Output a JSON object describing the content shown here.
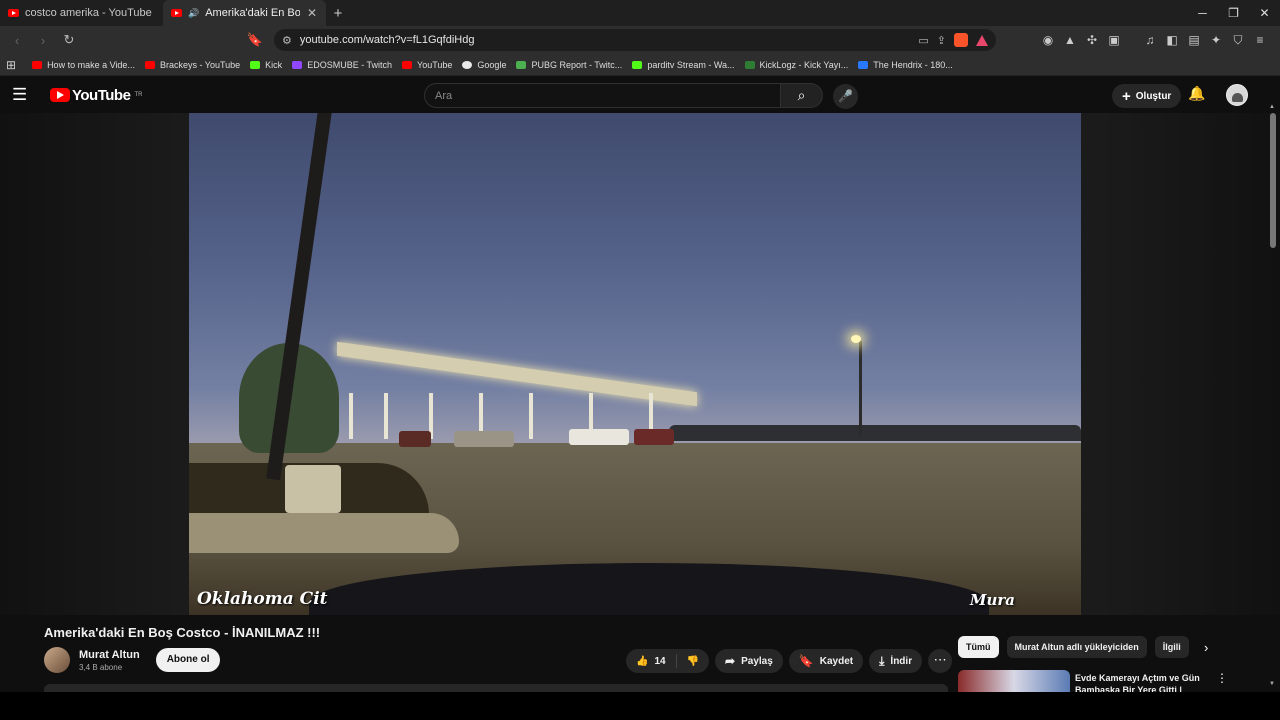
{
  "tabs": [
    {
      "title": "costco amerika - YouTube",
      "active": false
    },
    {
      "title": "Amerika'daki En Boş Costco ·",
      "active": true
    }
  ],
  "address": {
    "url": "youtube.com/watch?v=fL1GqfdiHdg"
  },
  "bookmarks": [
    {
      "label": "How to make a Vide...",
      "color": "#ff0000"
    },
    {
      "label": "Brackeys - YouTube",
      "color": "#ff0000"
    },
    {
      "label": "Kick",
      "color": "#53fc18"
    },
    {
      "label": "EDOSMUBE - Twitch",
      "color": "#9146ff"
    },
    {
      "label": "YouTube",
      "color": "#ff0000"
    },
    {
      "label": "Google",
      "color": "#e8e8e8"
    },
    {
      "label": "PUBG Report - Twitc...",
      "color": "#4caf50"
    },
    {
      "label": "parditv Stream - Wa...",
      "color": "#53fc18"
    },
    {
      "label": "KickLogz - Kick Yayı...",
      "color": "#2e7d32"
    },
    {
      "label": "The Hendrix - 180...",
      "color": "#2979ff"
    }
  ],
  "youtube": {
    "logo_text": "YouTube",
    "region": "TR",
    "search_placeholder": "Ara",
    "create_label": "Oluştur"
  },
  "video": {
    "watermark_left": "Oklahoma Cit",
    "watermark_right": "Mura",
    "title": "Amerika'daki En Boş Costco - İNANILMAZ !!!"
  },
  "channel": {
    "name": "Murat Altun",
    "subscribers": "3,4 B abone",
    "subscribe_label": "Abone ol"
  },
  "actions": {
    "like_count": "14",
    "share_label": "Paylaş",
    "save_label": "Kaydet",
    "download_label": "İndir"
  },
  "chips": [
    "Tümü",
    "Murat Altun adlı yükleyiciden",
    "İlgili"
  ],
  "recommendation": {
    "title": "Evde Kamerayı Açtım ve Gün Bambaşka Bir Yere Gitti | Günl..."
  },
  "colors": {
    "accent": "#ff0000",
    "background": "#0f0f0f",
    "pill": "#272727"
  }
}
